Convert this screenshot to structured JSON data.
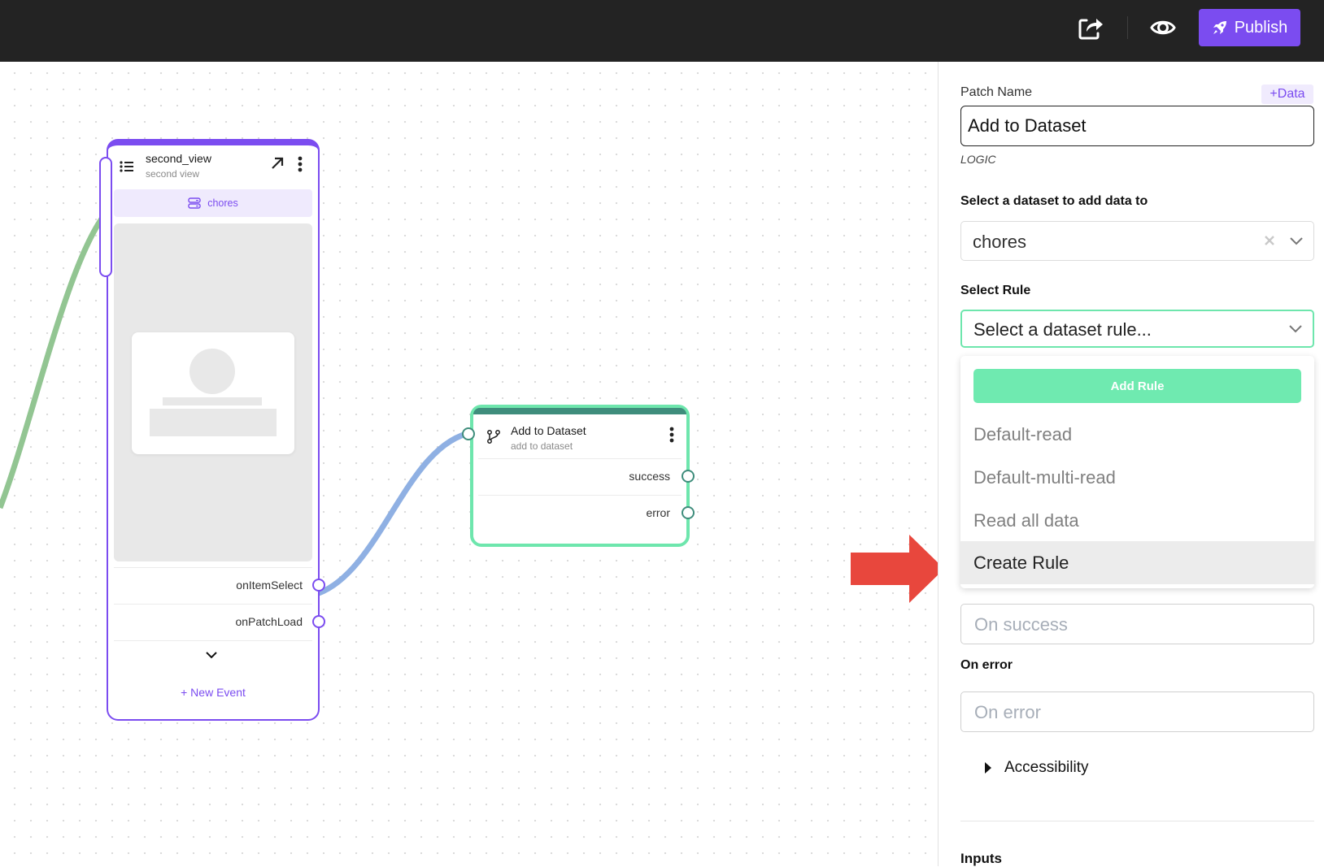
{
  "topbar": {
    "share_icon": "share-icon",
    "preview_icon": "eye-icon",
    "publish_label": "Publish",
    "publish_icon": "rocket-icon",
    "accent_color": "#7b4cf0"
  },
  "canvas": {
    "screen_node": {
      "title": "second_view",
      "subtitle": "second view",
      "dataset": "chores",
      "events": [
        "onItemSelect",
        "onPatchLoad"
      ],
      "new_event_label": "+ New Event"
    },
    "logic_node": {
      "title": "Add to Dataset",
      "subtitle": "add to dataset",
      "outputs": [
        "success",
        "error"
      ]
    }
  },
  "sidebar": {
    "patch_name_label": "Patch Name",
    "data_button_label": "+Data",
    "patch_name_value": "Add to Dataset",
    "patch_type": "LOGIC",
    "dataset_label": "Select a dataset to add data to",
    "dataset_value": "chores",
    "rule_label": "Select Rule",
    "rule_placeholder": "Select a dataset rule...",
    "rule_dropdown": {
      "add_rule_label": "Add Rule",
      "options": [
        "Default-read",
        "Default-multi-read",
        "Read all data",
        "Create Rule"
      ],
      "highlighted": "Create Rule"
    },
    "on_success_placeholder": "On success",
    "on_error_label": "On error",
    "on_error_placeholder": "On error",
    "accessibility_label": "Accessibility",
    "inputs_label": "Inputs"
  }
}
